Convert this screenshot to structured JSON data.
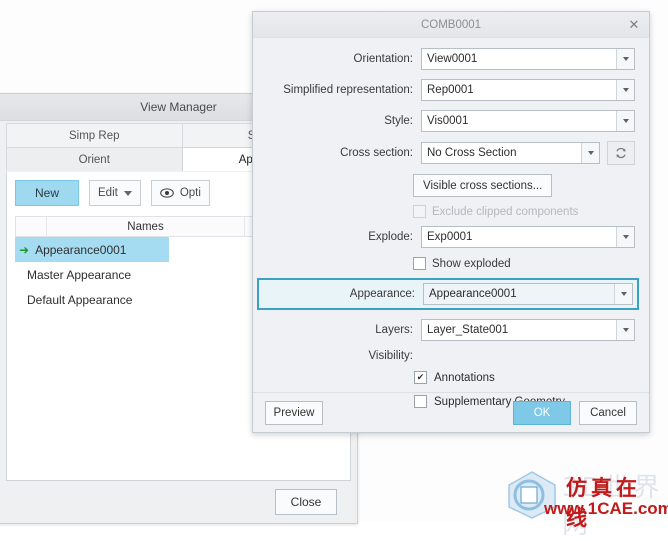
{
  "watermark": {
    "center_text": "1CAE",
    "logo_cn": "仿真在线",
    "logo_ghost": "3D世界网",
    "logo_url": "www.1CAE.com"
  },
  "view_manager": {
    "title": "View Manager",
    "tabs_row1": [
      {
        "label": "Simp Rep",
        "active": false
      },
      {
        "label": "Sections",
        "active": false
      }
    ],
    "tabs_row2": [
      {
        "label": "Orient",
        "active": false
      },
      {
        "label": "Appearance",
        "active": true
      }
    ],
    "toolbar": {
      "new_label": "New",
      "edit_label": "Edit",
      "options_label": "Opti",
      "eye_icon": "eye-icon",
      "caret_icon": "chevron-down-icon"
    },
    "list_header": {
      "names_column": "Names"
    },
    "items": [
      {
        "label": "Appearance0001",
        "selected": true,
        "marker": "green-arrow-icon"
      },
      {
        "label": "Master Appearance",
        "selected": false,
        "marker": ""
      },
      {
        "label": "Default Appearance",
        "selected": false,
        "marker": ""
      }
    ],
    "close_label": "Close"
  },
  "dialog": {
    "title": "COMB0001",
    "close_icon": "close-icon",
    "fields": {
      "orientation": {
        "label": "Orientation:",
        "value": "View0001"
      },
      "simplified_representation": {
        "label": "Simplified representation:",
        "value": "Rep0001"
      },
      "style": {
        "label": "Style:",
        "value": "Vis0001"
      },
      "cross_section": {
        "label": "Cross section:",
        "value": "No Cross Section"
      },
      "explode": {
        "label": "Explode:",
        "value": "Exp0001"
      },
      "appearance": {
        "label": "Appearance:",
        "value": "Appearance0001"
      },
      "layers": {
        "label": "Layers:",
        "value": "Layer_State001"
      }
    },
    "buttons": {
      "visible_cross_sections": "Visible cross sections...",
      "refresh_icon": "refresh-icon",
      "preview": "Preview",
      "ok": "OK",
      "cancel": "Cancel"
    },
    "checkboxes": {
      "exclude_clipped": {
        "label": "Exclude clipped components",
        "checked": false,
        "disabled": true
      },
      "show_exploded": {
        "label": "Show exploded",
        "checked": false,
        "disabled": false
      },
      "annotations": {
        "label": "Annotations",
        "checked": true,
        "mark": "✔"
      },
      "supplementary_geometry": {
        "label": "Supplementary Geometry",
        "checked": false,
        "mark": ""
      }
    },
    "visibility_label": "Visibility:",
    "highlight_color": "#3aa3c4"
  }
}
